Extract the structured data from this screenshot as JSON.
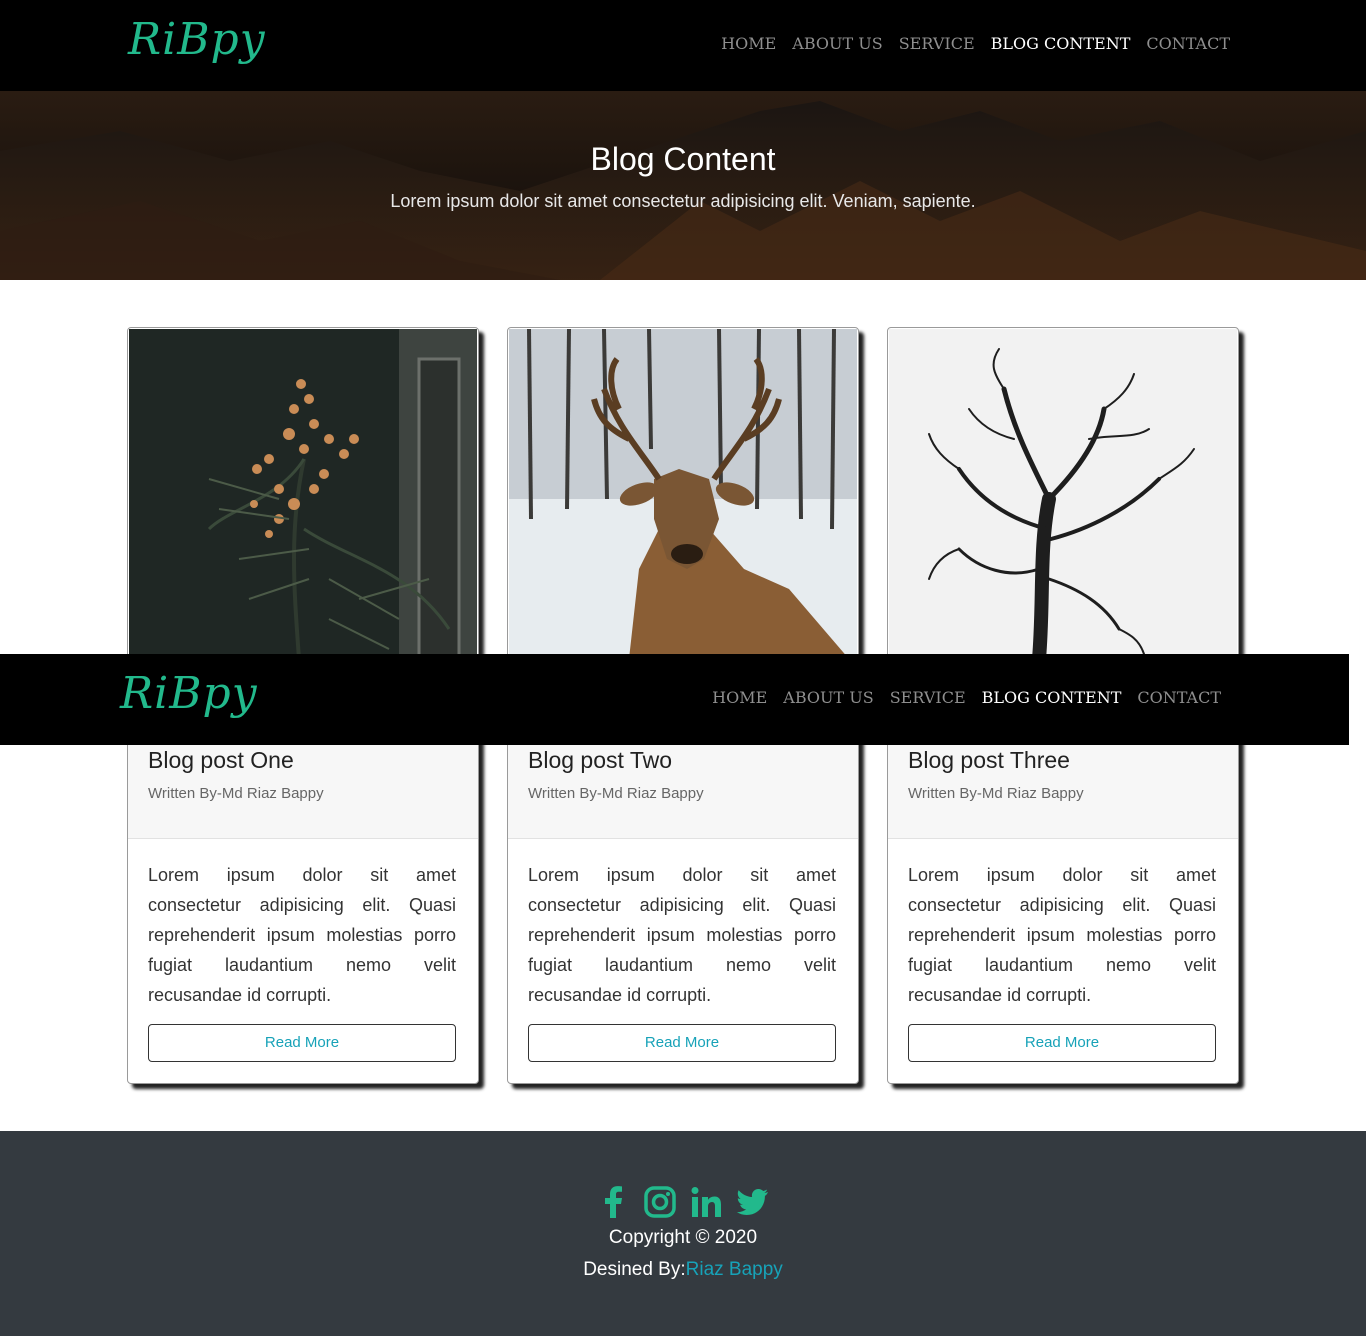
{
  "brand": {
    "logo": "RiBpy",
    "logo_color": "#22b98c"
  },
  "nav": {
    "items": [
      {
        "label": "HOME"
      },
      {
        "label": "ABOUT US"
      },
      {
        "label": "SERVICE"
      },
      {
        "label": "BLOG CONTENT"
      },
      {
        "label": "CONTACT"
      }
    ],
    "active": "BLOG CONTENT"
  },
  "hero": {
    "title": "Blog Content",
    "subtitle": "Lorem ipsum dolor sit amet consectetur adipisicing elit. Veniam, sapiente."
  },
  "cards": [
    {
      "title": "Blog post One",
      "author": "Written By-Md Riaz Bappy",
      "text": "Lorem ipsum dolor sit amet consectetur adipisicing elit. Quasi reprehenderit ipsum molestias porro fugiat laudantium nemo velit recusandae id corrupti.",
      "button": "Read More",
      "image": "flower-branch-photo"
    },
    {
      "title": "Blog post Two",
      "author": "Written By-Md Riaz Bappy",
      "text": "Lorem ipsum dolor sit amet consectetur adipisicing elit. Quasi reprehenderit ipsum molestias porro fugiat laudantium nemo velit recusandae id corrupti.",
      "button": "Read More",
      "image": "deer-in-snow-photo"
    },
    {
      "title": "Blog post Three",
      "author": "Written By-Md Riaz Bappy",
      "text": "Lorem ipsum dolor sit amet consectetur adipisicing elit. Quasi reprehenderit ipsum molestias porro fugiat laudantium nemo velit recusandae id corrupti.",
      "button": "Read More",
      "image": "bare-tree-photo"
    }
  ],
  "footer": {
    "social_icons": [
      "facebook-icon",
      "instagram-icon",
      "linkedin-icon",
      "twitter-icon"
    ],
    "icon_color": "#22b98c",
    "copyright": "Copyright © 2020",
    "designed_prefix": "Desined By:",
    "designed_name": "Riaz Bappy",
    "link_color": "#17a2b8"
  }
}
